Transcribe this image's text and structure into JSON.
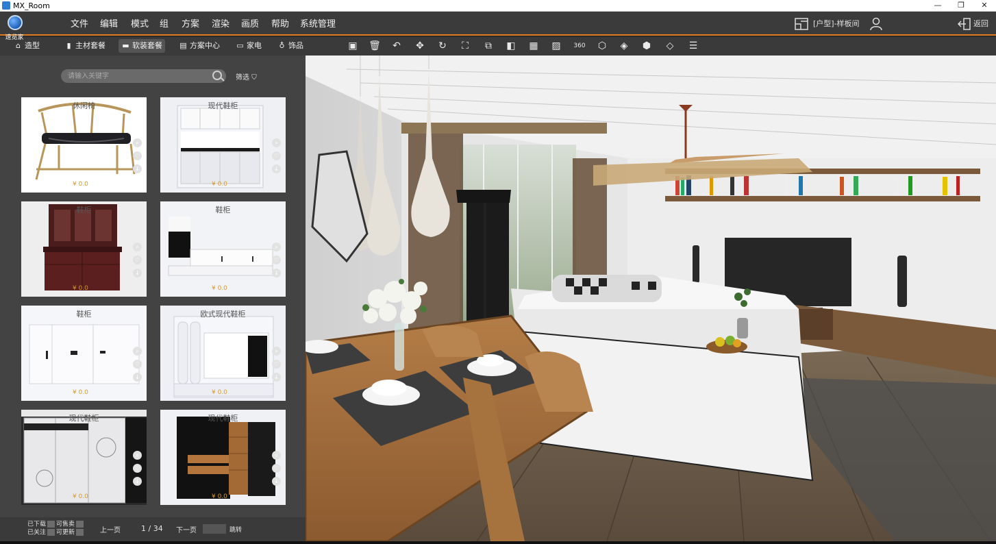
{
  "window": {
    "title": "MX_Room",
    "controls": [
      "—",
      "❐",
      "✕"
    ]
  },
  "logo": {
    "text": "速览家"
  },
  "menu": [
    "文件",
    "编辑",
    "模式",
    "组",
    "方案",
    "渲染",
    "画质",
    "帮助",
    "系统管理"
  ],
  "header_right": {
    "house_label": "[户型]-样板间",
    "back_label": "返回"
  },
  "category_tabs": [
    {
      "label": "造型",
      "active": false
    },
    {
      "label": "主材套餐",
      "active": false
    },
    {
      "label": "软装套餐",
      "active": true
    },
    {
      "label": "方案中心",
      "active": false
    },
    {
      "label": "家电",
      "active": false
    },
    {
      "label": "饰品",
      "active": false
    }
  ],
  "toolbar_icons": [
    "save-icon",
    "delete-icon",
    "undo-icon",
    "move-icon",
    "rotate-icon",
    "fit-view-icon",
    "group-icon",
    "layer-icon",
    "material-icon",
    "picture-icon",
    "panorama-360-icon",
    "cube-icon",
    "floor-icon",
    "box-view-icon",
    "tag-icon",
    "list-icon"
  ],
  "search": {
    "placeholder": "请输入关键字",
    "filter_label": "筛选"
  },
  "products": [
    {
      "name": "休闲椅",
      "price": "¥  0.0"
    },
    {
      "name": "现代鞋柜",
      "price": "¥  0.0"
    },
    {
      "name": "鞋柜",
      "price": "¥  0.0"
    },
    {
      "name": "鞋柜",
      "price": "¥  0.0"
    },
    {
      "name": "鞋柜",
      "price": "¥  0.0"
    },
    {
      "name": "欧式现代鞋柜",
      "price": "¥  0.0"
    },
    {
      "name": "现代鞋柜",
      "price": "¥  0.0"
    },
    {
      "name": "现代鞋柜",
      "price": "¥  0.0"
    }
  ],
  "pager": {
    "legend": {
      "downloaded": "已下载",
      "sellable": "可售卖",
      "followed": "已关注",
      "updatable": "可更新"
    },
    "prev": "上一页",
    "page": "1 / 34",
    "next": "下一页",
    "jump": "跳转"
  },
  "colors": {
    "accent": "#e07a1f",
    "price": "#d39a2a",
    "menubar": "#3b3b3b",
    "sidebar": "#434343"
  }
}
